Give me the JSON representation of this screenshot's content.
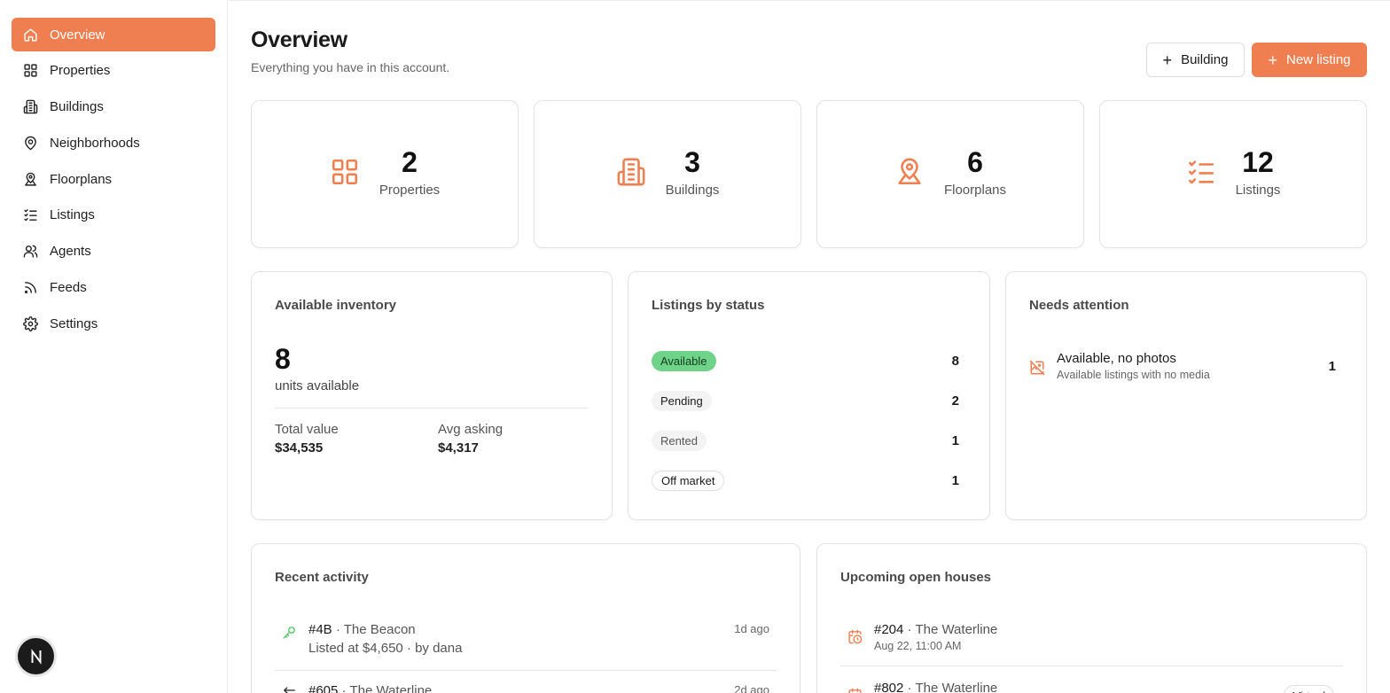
{
  "sidebar": {
    "items": [
      {
        "label": "Overview",
        "icon": "home-icon",
        "active": true
      },
      {
        "label": "Properties",
        "icon": "grid-icon"
      },
      {
        "label": "Buildings",
        "icon": "building-icon"
      },
      {
        "label": "Neighborhoods",
        "icon": "map-pin-icon"
      },
      {
        "label": "Floorplans",
        "icon": "map-pin-person-icon"
      },
      {
        "label": "Listings",
        "icon": "list-checks-icon"
      },
      {
        "label": "Agents",
        "icon": "users-icon"
      },
      {
        "label": "Feeds",
        "icon": "rss-icon"
      },
      {
        "label": "Settings",
        "icon": "gear-icon"
      }
    ],
    "avatar_letter": "N"
  },
  "header": {
    "title": "Overview",
    "subtitle": "Everything you have in this account.",
    "building_button": "Building",
    "new_listing_button": "New listing"
  },
  "stats": [
    {
      "value": "2",
      "label": "Properties",
      "icon": "grid-icon"
    },
    {
      "value": "3",
      "label": "Buildings",
      "icon": "building-icon"
    },
    {
      "value": "6",
      "label": "Floorplans",
      "icon": "map-pin-person-icon"
    },
    {
      "value": "12",
      "label": "Listings",
      "icon": "list-checks-icon"
    }
  ],
  "inventory": {
    "title": "Available inventory",
    "count": "8",
    "count_label": "units available",
    "total_value_label": "Total value",
    "total_value": "$34,535",
    "avg_asking_label": "Avg asking",
    "avg_asking": "$4,317"
  },
  "listings_by_status": {
    "title": "Listings by status",
    "rows": [
      {
        "status": "Available",
        "count": "8"
      },
      {
        "status": "Pending",
        "count": "2"
      },
      {
        "status": "Rented",
        "count": "1"
      },
      {
        "status": "Off market",
        "count": "1"
      }
    ]
  },
  "needs_attention": {
    "title": "Needs attention",
    "items": [
      {
        "title": "Available, no photos",
        "subtitle": "Available listings with no media",
        "count": "1",
        "icon": "image-off-icon"
      }
    ]
  },
  "recent_activity": {
    "title": "Recent activity",
    "items": [
      {
        "unit": "#4B",
        "building": "The Beacon",
        "detail": "Listed at $4,650 · by dana",
        "time": "1d ago",
        "icon": "key-icon"
      },
      {
        "unit": "#605",
        "building": "The Waterline",
        "detail": "",
        "time": "2d ago",
        "icon": "arrows-icon"
      }
    ]
  },
  "open_houses": {
    "title": "Upcoming open houses",
    "items": [
      {
        "unit": "#204",
        "building": "The Waterline",
        "date": "Aug 22, 11:00 AM",
        "badge": ""
      },
      {
        "unit": "#802",
        "building": "The Waterline",
        "date": "",
        "badge": "Virtual"
      }
    ]
  },
  "colors": {
    "accent": "#ef7f50",
    "available_pill": "#6fd38a",
    "activity_green": "#5cc46b"
  }
}
